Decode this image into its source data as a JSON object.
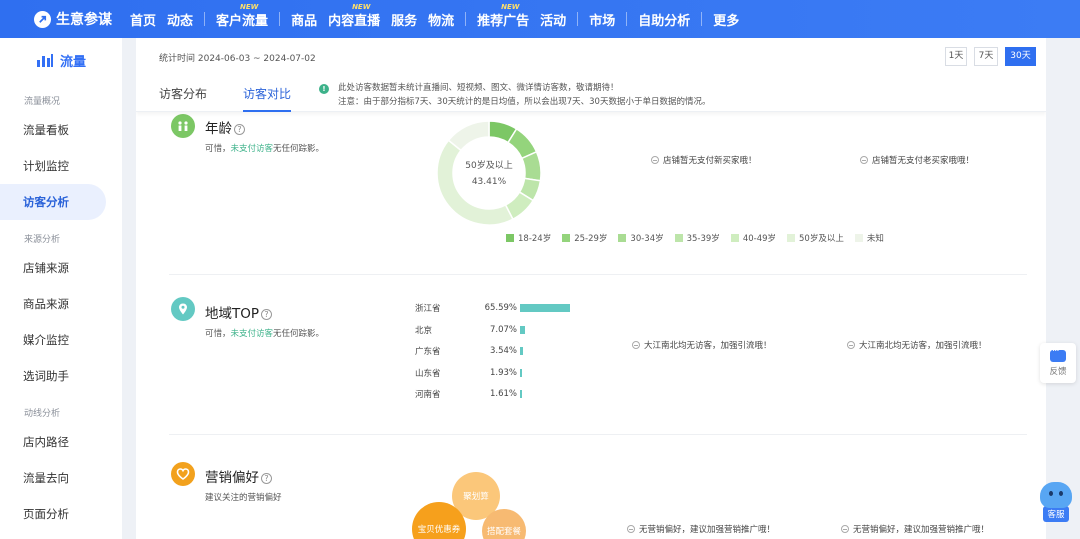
{
  "app": {
    "name": "生意参谋"
  },
  "nav": {
    "items": [
      {
        "label": "首页"
      },
      {
        "label": "动态"
      },
      {
        "label": "客户",
        "badge": "NEW"
      },
      {
        "label": "流量"
      },
      {
        "label": "商品"
      },
      {
        "label": "内容",
        "badge": "NEW"
      },
      {
        "label": "直播"
      },
      {
        "label": "服务"
      },
      {
        "label": "物流"
      },
      {
        "label": "推荐",
        "badge": "NEW"
      },
      {
        "label": "广告"
      },
      {
        "label": "活动"
      },
      {
        "label": "市场"
      },
      {
        "label": "自助分析"
      },
      {
        "label": "更多"
      }
    ]
  },
  "sidebar": {
    "title": "流量",
    "groups": [
      {
        "heading": "流量概况",
        "items": [
          "流量看板",
          "计划监控",
          "访客分析"
        ]
      },
      {
        "heading": "来源分析",
        "items": [
          "店铺来源",
          "商品来源",
          "媒介监控",
          "选词助手"
        ]
      },
      {
        "heading": "动线分析",
        "items": [
          "店内路径",
          "流量去向",
          "页面分析"
        ]
      }
    ],
    "active": "访客分析"
  },
  "header": {
    "stat_time": "统计时间 2024-06-03 ~ 2024-07-02",
    "ranges": [
      "1天",
      "7天",
      "30天"
    ],
    "active_range": "30天",
    "tabs": [
      "访客分布",
      "访客对比"
    ],
    "active_tab": "访客对比",
    "notice_icon": "!",
    "notice_line1": "此处访客数据暂未统计直播间、短视频、图文、微详情访客数，敬请期待！",
    "notice_line2": "注意：由于部分指标7天、30天统计的是日均值，所以会出现7天、30天数据小于单日数据的情况。"
  },
  "age": {
    "title": "年龄",
    "help": "?",
    "sub_prefix": "可惜，",
    "sub_highlight": "未支付访客",
    "sub_suffix": "无任何踪影。",
    "center_label": "50岁及以上",
    "center_value": "43.41%",
    "hint_new": "店铺暂无支付新买家哦！",
    "hint_old": "店铺暂无支付老买家哦哦！",
    "legend": [
      "18-24岁",
      "25-29岁",
      "30-34岁",
      "35-39岁",
      "40-49岁",
      "50岁及以上",
      "未知"
    ],
    "colors": [
      "#7cc765",
      "#94d47c",
      "#a9dc93",
      "#bde5aa",
      "#cfedbf",
      "#e2f2d8",
      "#eef4e9"
    ],
    "shares": [
      0.0889,
      0.0944,
      0.0907,
      0.0648,
      0.0852,
      0.4341,
      0.1419
    ]
  },
  "region": {
    "title": "地域TOP",
    "help": "?",
    "sub_prefix": "可惜，",
    "sub_highlight": "未支付访客",
    "sub_suffix": "无任何踪影。",
    "hint_a": "大江南北均无访客，加强引流哦！",
    "hint_b": "大江南北均无访客，加强引流哦！",
    "rows": [
      {
        "name": "浙江省",
        "pct": "65.59%",
        "value": 65.59
      },
      {
        "name": "北京",
        "pct": "7.07%",
        "value": 7.07
      },
      {
        "name": "广东省",
        "pct": "3.54%",
        "value": 3.54
      },
      {
        "name": "山东省",
        "pct": "1.93%",
        "value": 1.93
      },
      {
        "name": "河南省",
        "pct": "1.61%",
        "value": 1.61
      }
    ],
    "bar_color": "#63c9c3"
  },
  "marketing": {
    "title": "营销偏好",
    "help": "?",
    "sub": "建议关注的营销偏好",
    "bubbles": [
      "聚划算",
      "宝贝优惠券",
      "搭配套餐"
    ],
    "hint_a": "无营销偏好，建议加强营销推广哦！",
    "hint_b": "无营销偏好，建议加强营销推广哦！"
  },
  "floating": {
    "feedback": "反馈",
    "service": "客服"
  }
}
